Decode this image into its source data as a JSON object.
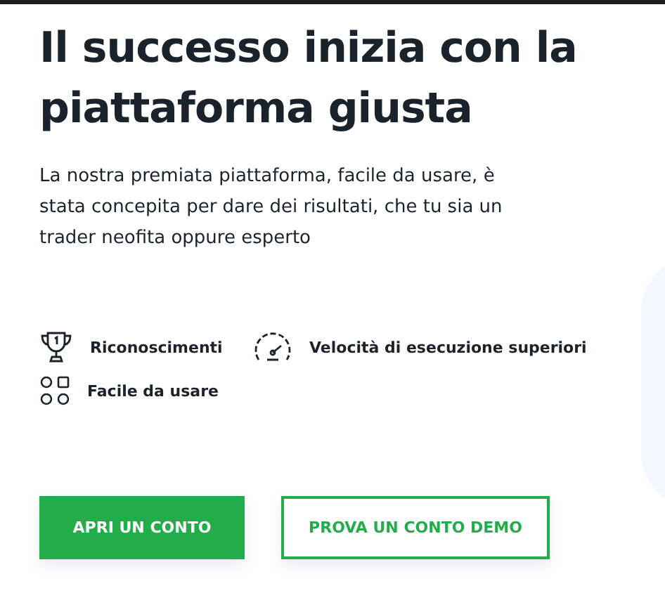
{
  "heading": "Il successo inizia con la piattaforma giusta",
  "description": "La nostra premiata piattaforma, facile da usare, è stata concepita per dare dei risultati, che tu sia un trader neofita oppure esperto",
  "features": [
    {
      "kind": "trophy",
      "label": "Riconoscimenti"
    },
    {
      "kind": "speedometer",
      "label": "Velocità di esecuzione superiori"
    },
    {
      "kind": "shapes",
      "label": "Facile da usare"
    }
  ],
  "buttons": [
    {
      "kind": "primary",
      "label": "APRI UN CONTO"
    },
    {
      "kind": "outline",
      "label": "PROVA UN CONTO DEMO"
    }
  ]
}
